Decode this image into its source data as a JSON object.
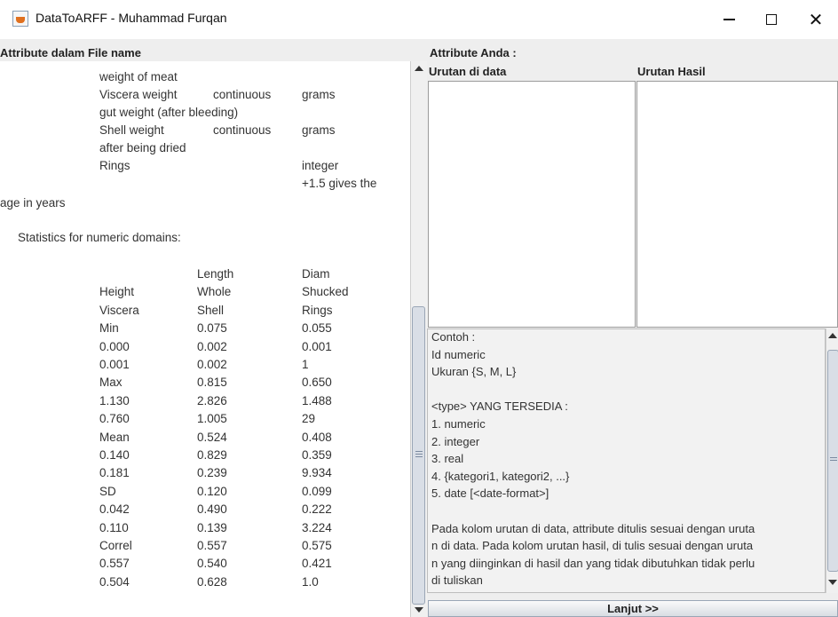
{
  "window": {
    "title": "DataToARFF - Muhammad Furqan",
    "minimize_glyph": "—",
    "maximize_glyph": "☐",
    "close_glyph": "✕",
    "icon": "java-app-icon"
  },
  "left": {
    "header": "Attribute dalam File name",
    "lines": [
      "weight of meat",
      "Viscera weight",
      "continuous",
      "grams",
      "gut weight (after bleeding)",
      "Shell weight",
      "continuous",
      "grams",
      "after being dried",
      "Rings",
      "integer",
      "+1.5 gives the",
      "age in years",
      "Statistics for numeric domains:"
    ],
    "stats_header": [
      [
        "",
        "Length",
        "Diam"
      ],
      [
        "Height",
        "Whole",
        "Shucked"
      ],
      [
        "Viscera",
        "Shell",
        "Rings"
      ]
    ],
    "stats_rows": [
      [
        "Min",
        "0.075",
        "0.055"
      ],
      [
        "0.000",
        "0.002",
        "0.001"
      ],
      [
        "0.001",
        "0.002",
        "1"
      ],
      [
        "Max",
        "0.815",
        "0.650"
      ],
      [
        "1.130",
        "2.826",
        "1.488"
      ],
      [
        "0.760",
        "1.005",
        "29"
      ],
      [
        "Mean",
        "0.524",
        "0.408"
      ],
      [
        "0.140",
        "0.829",
        "0.359"
      ],
      [
        "0.181",
        "0.239",
        "9.934"
      ],
      [
        "SD",
        "0.120",
        "0.099"
      ],
      [
        "0.042",
        "0.490",
        "0.222"
      ],
      [
        "0.110",
        "0.139",
        "3.224"
      ],
      [
        "Correl",
        "0.557",
        "0.575"
      ],
      [
        "0.557",
        "0.540",
        "0.421"
      ],
      [
        "0.504",
        "0.628",
        "1.0"
      ]
    ]
  },
  "right": {
    "header": "Attribute Anda :",
    "col1_header": "Urutan di data",
    "col2_header": "Urutan Hasil",
    "info_lines": [
      "Contoh :",
      " Id numeric",
      " Ukuran {S, M, L}",
      "",
      "<type> YANG TERSEDIA :",
      "1. numeric",
      "2. integer",
      "3. real",
      "4. {kategori1, kategori2, ...}",
      "5. date [<date-format>]",
      "",
      "Pada kolom urutan di data, attribute ditulis sesuai dengan uruta",
      "n di data. Pada kolom urutan hasil, di tulis sesuai dengan uruta",
      "n yang diinginkan di hasil dan yang tidak dibutuhkan tidak perlu",
      "di tuliskan"
    ],
    "button_label": "Lanjut >>"
  }
}
